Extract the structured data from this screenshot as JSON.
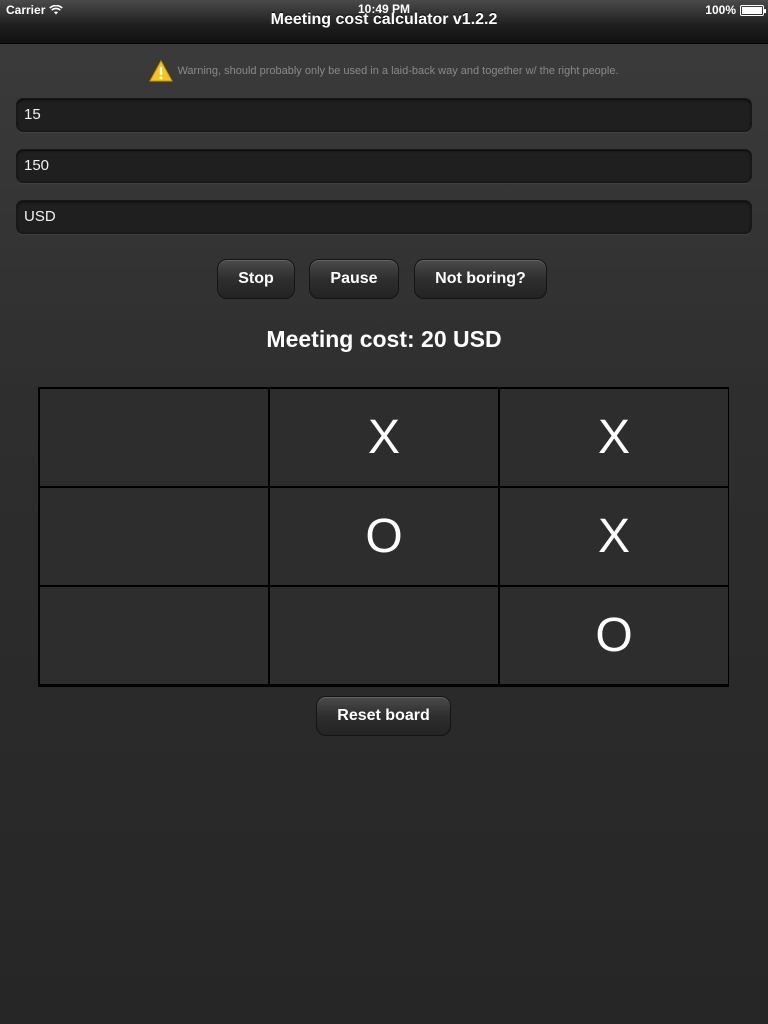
{
  "status_bar": {
    "carrier": "Carrier",
    "time": "10:49 PM",
    "battery": "100%"
  },
  "nav": {
    "title": "Meeting cost calculator v1.2.2"
  },
  "warning": {
    "text": "Warning, should probably only be used in a laid-back way and together w/ the right people.",
    "icon": "warning-icon"
  },
  "fields": [
    {
      "value": "15"
    },
    {
      "value": "150"
    },
    {
      "value": "USD"
    }
  ],
  "buttons": {
    "stop": "Stop",
    "pause": "Pause",
    "not_boring": "Not boring?",
    "reset": "Reset board"
  },
  "meeting_cost": "Meeting cost: 20 USD",
  "board": [
    [
      "",
      "X",
      "X"
    ],
    [
      "",
      "O",
      "X"
    ],
    [
      "",
      "",
      "O"
    ]
  ]
}
